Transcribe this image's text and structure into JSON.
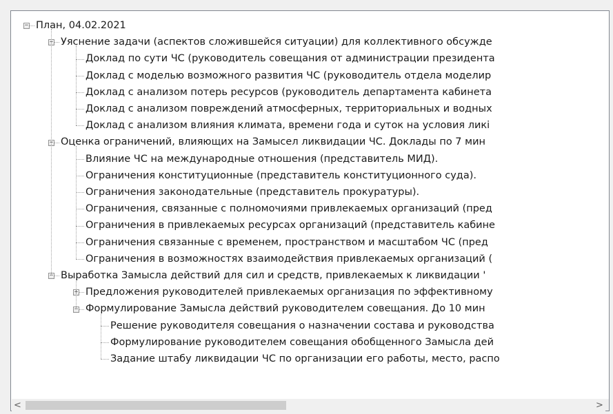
{
  "tree": {
    "nodes": [
      {
        "label": "План, 04.02.2021",
        "level": 0,
        "state": "expanded"
      },
      {
        "label": "Уяснение задачи (аспектов сложившейся ситуации) для коллективного обсужде",
        "level": 1,
        "state": "expanded"
      },
      {
        "label": "Доклад по сути ЧС (руководитель совещания от администрации президента",
        "level": 2,
        "state": "leaf"
      },
      {
        "label": "Доклад с моделью возможного развития ЧС (руководитель отдела моделир",
        "level": 2,
        "state": "leaf"
      },
      {
        "label": "Доклад с анализом потерь ресурсов (руководитель департамента кабинета",
        "level": 2,
        "state": "leaf"
      },
      {
        "label": "Доклад с анализом повреждений атмосферных, территориальных и водных",
        "level": 2,
        "state": "leaf"
      },
      {
        "label": "Доклад с анализом влияния климата, времени года и суток на условия ликі",
        "level": 2,
        "state": "leaf"
      },
      {
        "label": "Оценка ограничений, влияющих на Замысел ликвидации ЧС. Доклады по 7 мин",
        "level": 1,
        "state": "expanded"
      },
      {
        "label": "Влияние ЧС на международные отношения (представитель МИД).",
        "level": 2,
        "state": "leaf"
      },
      {
        "label": "Ограничения конституционные (представитель конституционного суда).",
        "level": 2,
        "state": "leaf"
      },
      {
        "label": "Ограничения законодательные (представитель прокуратуры).",
        "level": 2,
        "state": "leaf"
      },
      {
        "label": "Ограничения, связанные с полномочиями привлекаемых организаций (пред",
        "level": 2,
        "state": "leaf"
      },
      {
        "label": "Ограничения в привлекаемых ресурсах организаций (представитель кабине",
        "level": 2,
        "state": "leaf"
      },
      {
        "label": "Ограничения связанные с временем, пространством и масштабом ЧС (пред",
        "level": 2,
        "state": "leaf"
      },
      {
        "label": "Ограничения в возможностях взаимодействия привлекаемых организаций (",
        "level": 2,
        "state": "leaf"
      },
      {
        "label": "Выработка Замысла действий для сил и средств, привлекаемых к ликвидации '",
        "level": 1,
        "state": "expanded"
      },
      {
        "label": "Предложения руководителей привлекаемых организация по эффективному",
        "level": 2,
        "state": "collapsed"
      },
      {
        "label": "Формулирование Замысла действий руководителем совещания. До 10 мин",
        "level": 2,
        "state": "expanded"
      },
      {
        "label": "Решение руководителя совещания о назначении состава и руководства",
        "level": 3,
        "state": "leaf"
      },
      {
        "label": "Формулирование руководителем совещания обобщенного Замысла дей",
        "level": 3,
        "state": "leaf"
      },
      {
        "label": "Задание штабу ликвидации ЧС по организации его работы, место, распо",
        "level": 3,
        "state": "leaf"
      }
    ]
  },
  "scrollbar": {
    "left_arrow": "<",
    "right_arrow": ">",
    "position": 0.0,
    "visible_fraction": 0.46
  }
}
